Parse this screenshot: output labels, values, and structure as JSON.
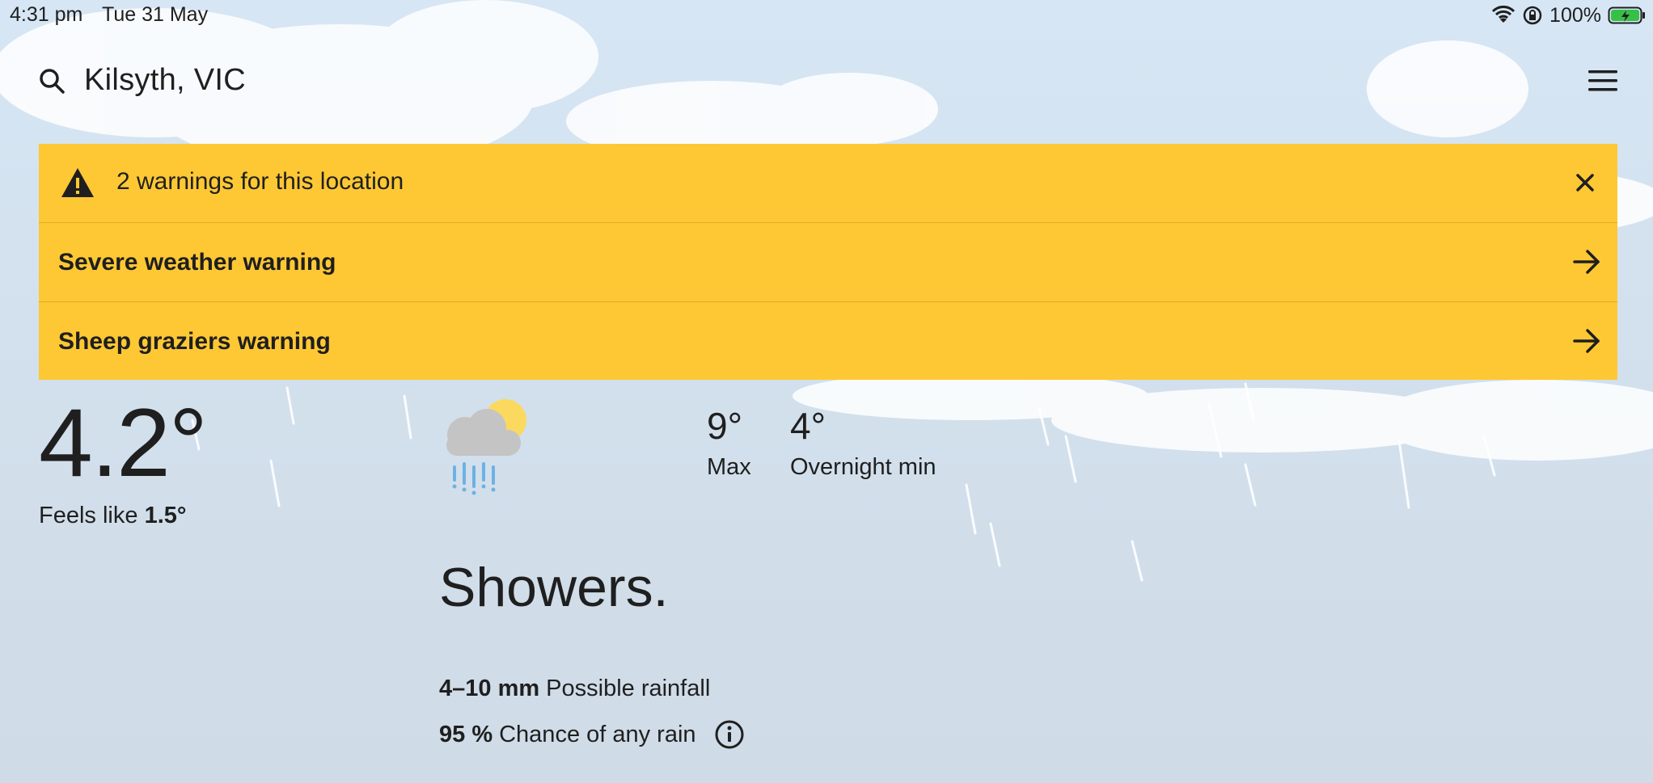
{
  "status_bar": {
    "time": "4:31 pm",
    "date": "Tue 31 May",
    "battery": "100%",
    "icons": [
      "wifi-icon",
      "orientation-lock-icon",
      "battery-charging-icon"
    ]
  },
  "header": {
    "location": "Kilsyth, VIC",
    "icons": [
      "search-icon",
      "menu-icon"
    ]
  },
  "warnings": {
    "summary": "2 warnings for this location",
    "items": [
      {
        "label": "Severe weather warning"
      },
      {
        "label": "Sheep graziers warning"
      }
    ],
    "background_color": "#fec834",
    "icons": [
      "alert-triangle-icon",
      "close-icon",
      "arrow-right-icon"
    ]
  },
  "current": {
    "temperature": "4.2°",
    "feels_like_label": "Feels like",
    "feels_like_value": "1.5°"
  },
  "forecast": {
    "icon": "showers-partly-sunny-icon",
    "max_value": "9°",
    "max_label": "Max",
    "min_value": "4°",
    "min_label": "Overnight min",
    "condition": "Showers.",
    "rainfall_amount": "4–10 mm",
    "rainfall_label": "Possible rainfall",
    "rain_chance": "95 %",
    "rain_chance_label": "Chance of any rain"
  }
}
